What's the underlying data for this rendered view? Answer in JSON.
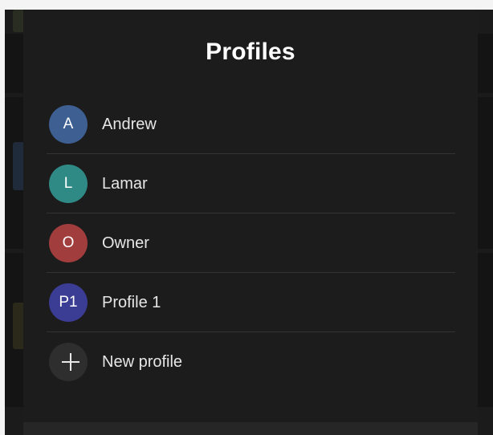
{
  "dialog": {
    "title": "Profiles"
  },
  "profiles": [
    {
      "initials": "A",
      "name": "Andrew",
      "color": "#3d5f92"
    },
    {
      "initials": "L",
      "name": "Lamar",
      "color": "#2f8a86"
    },
    {
      "initials": "O",
      "name": "Owner",
      "color": "#a23d3d"
    },
    {
      "initials": "P1",
      "name": "Profile 1",
      "color": "#3b3c93"
    }
  ],
  "new_profile": {
    "label": "New profile",
    "icon": "plus-icon",
    "color": "#2e2e2e"
  }
}
